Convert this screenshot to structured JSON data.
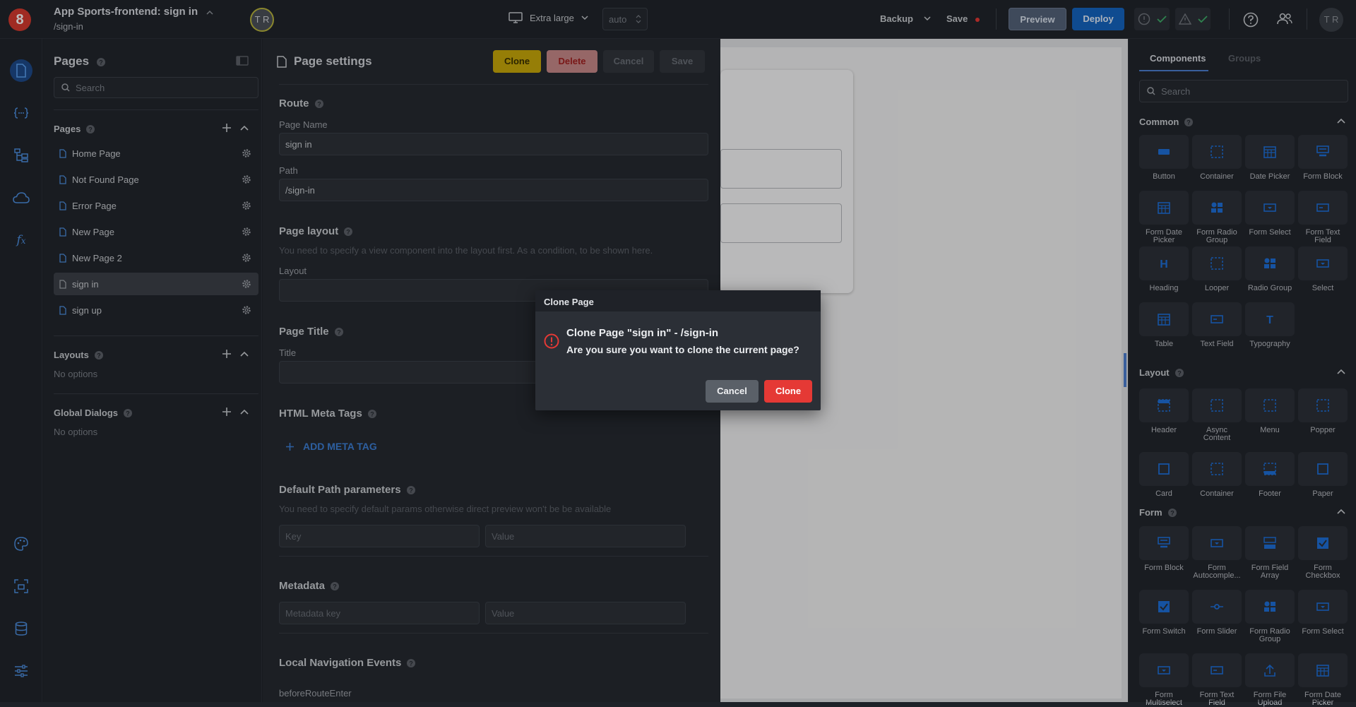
{
  "app": {
    "title": "App Sports-frontend: sign in",
    "path": "/sign-in",
    "collab_initials": "T R",
    "user_initials": "T R"
  },
  "toolbar": {
    "device": "Extra large",
    "width_value": "auto",
    "backup": "Backup",
    "save": "Save",
    "preview": "Preview",
    "deploy": "Deploy"
  },
  "pages_panel": {
    "title": "Pages",
    "search_placeholder": "Search",
    "pages_section": "Pages",
    "pages": [
      {
        "label": "Home Page"
      },
      {
        "label": "Not Found Page"
      },
      {
        "label": "Error Page"
      },
      {
        "label": "New Page"
      },
      {
        "label": "New Page 2"
      },
      {
        "label": "sign in",
        "selected": true
      },
      {
        "label": "sign up"
      }
    ],
    "layouts_section": "Layouts",
    "layouts_empty": "No options",
    "dialogs_section": "Global Dialogs",
    "dialogs_empty": "No options"
  },
  "page_settings": {
    "title": "Page settings",
    "buttons": {
      "clone": "Clone",
      "delete": "Delete",
      "cancel": "Cancel",
      "save": "Save"
    },
    "route": {
      "label": "Route",
      "name_label": "Page Name",
      "name_value": "sign in",
      "path_label": "Path",
      "path_value": "/sign-in"
    },
    "layout": {
      "label": "Page layout",
      "hint": "You need to specify a view component into the layout first. As a condition, to be shown here.",
      "field_label": "Layout"
    },
    "page_title": {
      "label": "Page Title",
      "field_label": "Title"
    },
    "meta": {
      "label": "HTML Meta Tags",
      "add": "ADD META TAG"
    },
    "path_params": {
      "label": "Default Path parameters",
      "hint": "You need to specify default params otherwise direct preview won't be be available",
      "key_placeholder": "Key",
      "value_placeholder": "Value"
    },
    "metadata": {
      "label": "Metadata",
      "key_placeholder": "Metadata key",
      "value_placeholder": "Value"
    },
    "nav_events": {
      "label": "Local Navigation Events",
      "before": "beforeRouteEnter"
    }
  },
  "components_panel": {
    "tabs": [
      "Components",
      "Groups"
    ],
    "search_placeholder": "Search",
    "common": {
      "title": "Common",
      "items": [
        "Button",
        "Container",
        "Date Picker",
        "Form Block",
        "Form Date Picker",
        "Form Radio Group",
        "Form Select",
        "Form Text Field",
        "Heading",
        "Looper",
        "Radio Group",
        "Select",
        "Table",
        "Text Field",
        "Typography"
      ]
    },
    "layout": {
      "title": "Layout",
      "items": [
        "Header",
        "Async Content",
        "Menu",
        "Popper",
        "Card",
        "Container",
        "Footer",
        "Paper"
      ]
    },
    "form": {
      "title": "Form",
      "items": [
        "Form Block",
        "Form Autocomple...",
        "Form Field Array",
        "Form Checkbox",
        "Form Switch",
        "Form Slider",
        "Form Radio Group",
        "Form Select",
        "Form Multiselect",
        "Form Text Field",
        "Form File Upload",
        "Form Date Picker"
      ]
    }
  },
  "dialog": {
    "header": "Clone Page",
    "message": "Clone Page \"sign in\" - /sign-in",
    "question": "Are you sure you want to clone the current page?",
    "cancel": "Cancel",
    "confirm": "Clone"
  },
  "colors": {
    "accent": "#1565c0",
    "danger": "#e53935",
    "clone_btn": "#c9a80a",
    "icon_blue": "#1e6fd9"
  }
}
